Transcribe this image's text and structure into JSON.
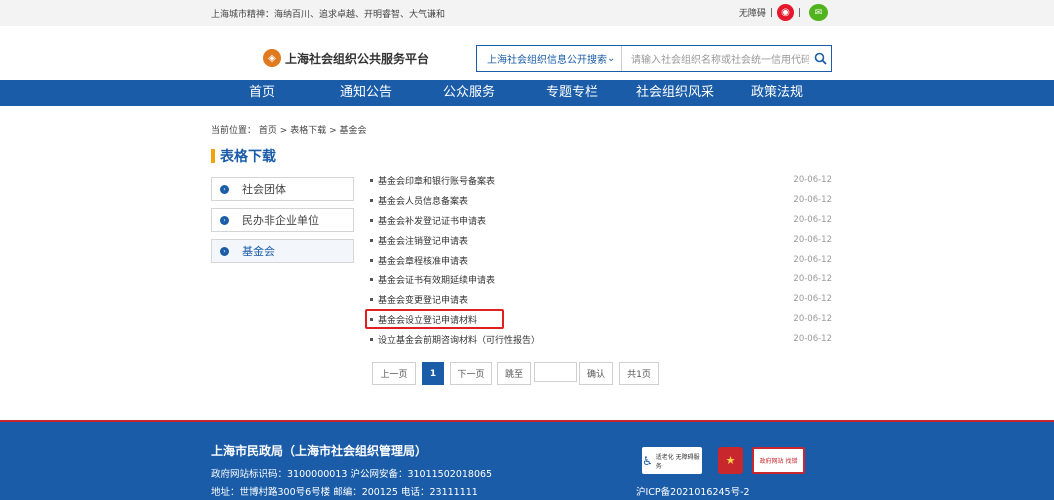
{
  "topbar": {
    "slogan": "上海城市精神：海纳百川、追求卓越、开明睿智、大气谦和",
    "accessibility": "无障碍",
    "divider": "|",
    "weibo_icon": "weibo-icon",
    "wechat_icon": "wechat-icon"
  },
  "header": {
    "logo_text": "上海社会组织公共服务平台",
    "search": {
      "select_value": "上海社会组织信息公开搜索",
      "placeholder": "请输入社会组织名称或社会统一信用代码"
    }
  },
  "nav": {
    "items": [
      "首页",
      "通知公告",
      "公众服务",
      "专题专栏",
      "社会组织风采",
      "政策法规"
    ]
  },
  "breadcrumb": {
    "prefix": "当前位置：",
    "items": [
      "首页",
      "表格下载",
      "基金会"
    ],
    "sep": ">"
  },
  "section_title": "表格下载",
  "sidebar": {
    "items": [
      {
        "label": "社会团体",
        "active": false
      },
      {
        "label": "民办非企业单位",
        "active": false
      },
      {
        "label": "基金会",
        "active": true
      }
    ]
  },
  "list": [
    {
      "title": "基金会印章和银行账号备案表",
      "date": "20-06-12"
    },
    {
      "title": "基金会人员信息备案表",
      "date": "20-06-12"
    },
    {
      "title": "基金会补发登记证书申请表",
      "date": "20-06-12"
    },
    {
      "title": "基金会注销登记申请表",
      "date": "20-06-12"
    },
    {
      "title": "基金会章程核准申请表",
      "date": "20-06-12"
    },
    {
      "title": "基金会证书有效期延续申请表",
      "date": "20-06-12"
    },
    {
      "title": "基金会变更登记申请表",
      "date": "20-06-12"
    },
    {
      "title": "基金会设立登记申请材料",
      "date": "20-06-12"
    },
    {
      "title": "设立基金会前期咨询材料（可行性报告）",
      "date": "20-06-12"
    }
  ],
  "pager": {
    "prev": "上一页",
    "current": "1",
    "next": "下一页",
    "jump": "跳至",
    "jump_value": "",
    "confirm": "确认",
    "total": "共1页"
  },
  "footer": {
    "title": "上海市民政局（上海市社会组织管理局）",
    "line1": "政府网站标识码：3100000013 沪公网安备：31011502018065",
    "line2": "地址：世博村路300号6号楼    邮编：200125    电话：23111111",
    "icp": "沪ICP备2021016245号-2",
    "badge_accessibility": "适老化 无障碍服务",
    "badge_error": "政府网站 找错"
  },
  "colors": {
    "brand_blue": "#1a5ca8",
    "accent_orange": "#f0a30a",
    "highlight_red": "#e02020"
  }
}
